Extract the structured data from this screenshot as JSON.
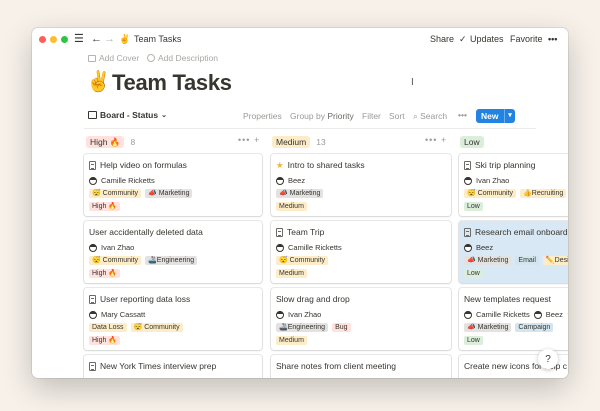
{
  "titlebar": {
    "breadcrumb_icon": "✌",
    "title": "Team Tasks",
    "share": "Share",
    "updates": "Updates",
    "favorite": "Favorite",
    "more": "•••"
  },
  "page": {
    "add_cover": "Add Cover",
    "add_description": "Add Description",
    "icon": "✌️",
    "title": "Team Tasks"
  },
  "toolbar": {
    "view": "Board - Status",
    "properties": "Properties",
    "group_by_prefix": "Group by",
    "group_by_value": "Priority",
    "filter": "Filter",
    "sort": "Sort",
    "search": "Search",
    "more": "•••",
    "new": "New"
  },
  "columns": [
    {
      "label": "High 🔥",
      "count": "8",
      "color": "#ffe2dd"
    },
    {
      "label": "Medium",
      "count": "13",
      "color": "#fdecc8"
    },
    {
      "label": "Low",
      "count": "",
      "color": "#dbeddb"
    }
  ],
  "cards": {
    "c0": {
      "title": "Help video on formulas",
      "person": "Camille Ricketts",
      "tags": [
        "😴 Community",
        "📣 Marketing"
      ],
      "priority": "High 🔥"
    },
    "c1": {
      "title": "User accidentally deleted data",
      "person": "Ivan Zhao",
      "tags": [
        "😴 Community",
        "🚢Engineering"
      ],
      "priority": "High 🔥"
    },
    "c2": {
      "title": "User reporting data loss",
      "person": "Mary Cassatt",
      "tags": [
        "Data Loss",
        "😴 Community"
      ],
      "priority": "High 🔥"
    },
    "c3": {
      "title": "New York Times interview prep"
    },
    "m0": {
      "title": "Intro to shared tasks",
      "person": "Beez",
      "tags": [
        "📣 Marketing"
      ],
      "priority": "Medium"
    },
    "m1": {
      "title": "Team Trip",
      "person": "Camille Ricketts",
      "tags": [
        "😴 Community"
      ],
      "priority": "Medium"
    },
    "m2": {
      "title": "Slow drag and drop",
      "person": "Ivan Zhao",
      "tags": [
        "🚢Engineering",
        "Bug"
      ],
      "priority": "Medium"
    },
    "m3": {
      "title": "Share notes from client meeting"
    },
    "l0": {
      "title": "Ski trip planning",
      "person": "Ivan Zhao",
      "tags": [
        "😴 Community",
        "👍Recruiting"
      ],
      "priority": "Low"
    },
    "l1": {
      "title": "Research email onboard",
      "person": "Beez",
      "tags": [
        "📣 Marketing",
        "Email",
        "✏️Desig"
      ],
      "priority": "Low"
    },
    "l2": {
      "title": "New templates request",
      "person": "Camille Ricketts",
      "person2": "Beez",
      "tags": [
        "📣 Marketing",
        "Campaign"
      ],
      "priority": "Low"
    },
    "l3": {
      "title": "Create new icons for help c"
    }
  },
  "help": "?"
}
